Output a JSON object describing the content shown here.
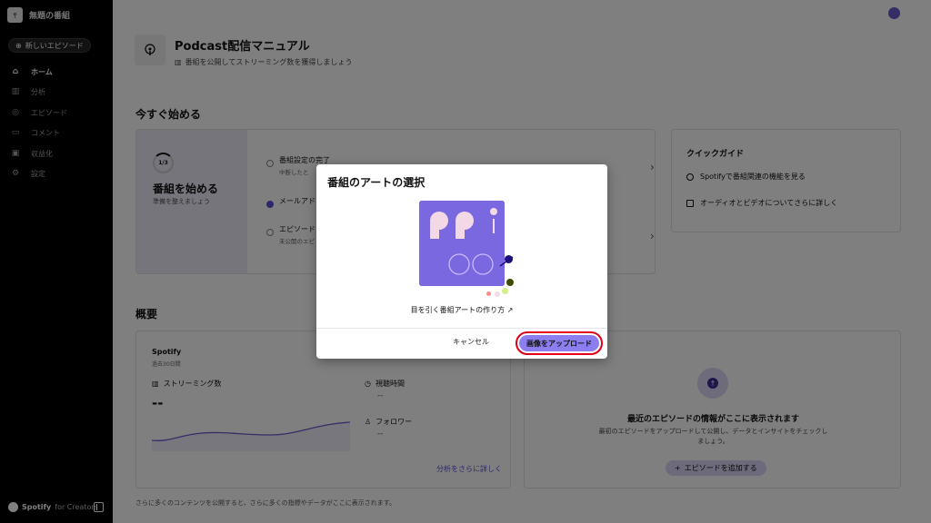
{
  "sidebar": {
    "show_title": "無題の番組",
    "new_episode": "新しいエピソード",
    "items": [
      {
        "label": "ホーム",
        "icon": "home-icon"
      },
      {
        "label": "分析",
        "icon": "bar-chart-icon"
      },
      {
        "label": "エピソード",
        "icon": "podcast-icon"
      },
      {
        "label": "コメント",
        "icon": "comment-icon"
      },
      {
        "label": "収益化",
        "icon": "money-icon"
      },
      {
        "label": "設定",
        "icon": "gear-icon"
      }
    ],
    "brand": "Spotify",
    "brand_sub": "for Creators"
  },
  "guide": {
    "title": "Podcast配信マニュアル",
    "subtitle": "番組を公開してストリーミング数を獲得しましょう"
  },
  "start_section": {
    "heading": "今すぐ始める",
    "progress": "1/3",
    "title": "番組を始める",
    "subtitle": "準備を整えましょう",
    "tasks": [
      {
        "title": "番組設定の完了",
        "sub": "中断したと"
      },
      {
        "title": "メールアド",
        "sub": ""
      },
      {
        "title": "エピソード",
        "sub": "未公開のエピ"
      }
    ]
  },
  "quick_guide": {
    "title": "クイックガイド",
    "items": [
      "Spotifyで番組関連の機能を見る",
      "オーディオとビデオについてさらに詳しく"
    ]
  },
  "overview": {
    "heading": "概要",
    "source": "Spotify",
    "period": "過去30日間",
    "streams_label": "ストリーミング数",
    "streams_value": "--",
    "time_label": "視聴時間",
    "time_value": "--",
    "followers_label": "フォロワー",
    "followers_value": "--",
    "more_link": "分析をさらに詳しく"
  },
  "episode_card": {
    "title": "最近のエピソードの情報がここに表示されます",
    "desc": "最初のエピソードをアップロードして公開し、データとインサイトをチェックしましょう。",
    "button": "エピソードを追加する"
  },
  "footer_note": "さらに多くのコンテンツを公開すると、さらに多くの指標やデータがここに表示されます。",
  "modal": {
    "title": "番組のアートの選択",
    "link": "目を引く番組アートの作り方",
    "cancel": "キャンセル",
    "upload": "画像をアップロード"
  },
  "colors": {
    "accent": "#8d7ef0",
    "highlight_ring": "#e0001b",
    "art_bg": "#7a68e0"
  }
}
